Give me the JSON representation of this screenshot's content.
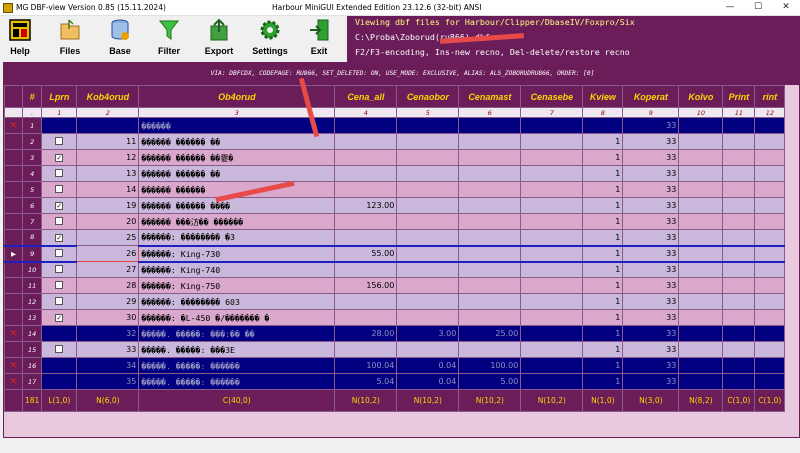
{
  "window": {
    "title": "MG DBF-view   Version 0.85 (15.11.2024)",
    "title_center": "Harbour MiniGUI Extended Edition 23.12.6 (32-bit) ANSI",
    "minimize": "—",
    "maximize": "☐",
    "close": "✕"
  },
  "toolbar": {
    "buttons": [
      {
        "label": "Help",
        "icon": "help-icon"
      },
      {
        "label": "Files",
        "icon": "folder-icon"
      },
      {
        "label": "Base",
        "icon": "database-icon"
      },
      {
        "label": "Filter",
        "icon": "filter-icon"
      },
      {
        "label": "Export",
        "icon": "export-icon"
      },
      {
        "label": "Settings",
        "icon": "gear-icon"
      },
      {
        "label": "Exit",
        "icon": "exit-icon"
      }
    ]
  },
  "info": {
    "line1": "Viewing dbf files for Harbour/Clipper/DbaseIV/Foxpro/Six",
    "line2": "C:\\Proba\\Zoborud(ru866).dbf",
    "line3": "F2/F3-encoding,   Ins-new recno, Del-delete/restore recno"
  },
  "grid": {
    "via_text": "VIA: DBFCDX, CODEPAGE: RU866, SET_DELETED: ON, USE_MODE: EXCLUSIVE, ALIAS: ALS_ZOBORUDRU866, ORDER: [0]",
    "headers": [
      "#",
      "Lprn",
      "Kob4orud",
      "Ob4orud",
      "Cena_all",
      "Cenaobor",
      "Cenamast",
      "Cenasebe",
      "Kview",
      "Koperat",
      "Kolvo",
      "Print",
      "rint"
    ],
    "col_numbers": [
      ".",
      "1",
      "2",
      "3",
      "4",
      "5",
      "6",
      "7",
      "8",
      "9",
      "10",
      "11",
      "12"
    ],
    "rows": [
      {
        "n": "1",
        "style": "del",
        "mark": "x",
        "lprn": "",
        "kob": "",
        "ob": "������",
        "cena_all": "",
        "cenaobor": "",
        "cenamast": "",
        "cenasebe": "",
        "kview": "",
        "koperat": "33",
        "kolvo": "",
        "print": "",
        "rint": ""
      },
      {
        "n": "2",
        "style": "a",
        "mark": "",
        "lprn": "☐",
        "kob": "11",
        "ob": "������ ������ ��",
        "cena_all": "",
        "cenaobor": "",
        "cenamast": "",
        "cenasebe": "",
        "kview": "1",
        "koperat": "33",
        "kolvo": "",
        "print": "",
        "rint": ""
      },
      {
        "n": "3",
        "style": "b",
        "mark": "",
        "lprn": "☑",
        "kob": "12",
        "ob": "������ ������ ��霎�",
        "cena_all": "",
        "cenaobor": "",
        "cenamast": "",
        "cenasebe": "",
        "kview": "1",
        "koperat": "33",
        "kolvo": "",
        "print": "",
        "rint": ""
      },
      {
        "n": "4",
        "style": "a",
        "mark": "",
        "lprn": "☐",
        "kob": "13",
        "ob": "������ ������ ��",
        "cena_all": "",
        "cenaobor": "",
        "cenamast": "",
        "cenasebe": "",
        "kview": "1",
        "koperat": "33",
        "kolvo": "",
        "print": "",
        "rint": ""
      },
      {
        "n": "5",
        "style": "b",
        "mark": "",
        "lprn": "☐",
        "kob": "14",
        "ob": "������ ������",
        "cena_all": "",
        "cenaobor": "",
        "cenamast": "",
        "cenasebe": "",
        "kview": "1",
        "koperat": "33",
        "kolvo": "",
        "print": "",
        "rint": ""
      },
      {
        "n": "6",
        "style": "a",
        "mark": "",
        "lprn": "☑",
        "kob": "19",
        "ob": "������ ������ ����",
        "cena_all": "123.00",
        "cenaobor": "",
        "cenamast": "",
        "cenasebe": "",
        "kview": "1",
        "koperat": "33",
        "kolvo": "",
        "print": "",
        "rint": ""
      },
      {
        "n": "7",
        "style": "b",
        "mark": "",
        "lprn": "☐",
        "kob": "20",
        "ob": "������ ���汸�� ������",
        "cena_all": "",
        "cenaobor": "",
        "cenamast": "",
        "cenasebe": "",
        "kview": "1",
        "koperat": "33",
        "kolvo": "",
        "print": "",
        "rint": ""
      },
      {
        "n": "8",
        "style": "a",
        "mark": "",
        "lprn": "☑",
        "kob": "25",
        "ob": "������: �������� �3",
        "cena_all": "",
        "cenaobor": "",
        "cenamast": "",
        "cenasebe": "",
        "kview": "1",
        "koperat": "33",
        "kolvo": "",
        "print": "",
        "rint": ""
      },
      {
        "n": "9",
        "style": "sel",
        "mark": "",
        "lprn": "☐",
        "kob": "26",
        "ob": "������: King-730",
        "cena_all": "55.00",
        "cenaobor": "",
        "cenamast": "",
        "cenasebe": "",
        "kview": "1",
        "koperat": "33",
        "kolvo": "",
        "print": "",
        "rint": ""
      },
      {
        "n": "10",
        "style": "a",
        "mark": "",
        "lprn": "☐",
        "kob": "27",
        "ob": "������: King-740",
        "cena_all": "",
        "cenaobor": "",
        "cenamast": "",
        "cenasebe": "",
        "kview": "1",
        "koperat": "33",
        "kolvo": "",
        "print": "",
        "rint": ""
      },
      {
        "n": "11",
        "style": "b",
        "mark": "",
        "lprn": "☐",
        "kob": "28",
        "ob": "������: King-750",
        "cena_all": "156.00",
        "cenaobor": "",
        "cenamast": "",
        "cenasebe": "",
        "kview": "1",
        "koperat": "33",
        "kolvo": "",
        "print": "",
        "rint": ""
      },
      {
        "n": "12",
        "style": "a",
        "mark": "",
        "lprn": "☐",
        "kob": "29",
        "ob": "������: �������� 603",
        "cena_all": "",
        "cenaobor": "",
        "cenamast": "",
        "cenasebe": "",
        "kview": "1",
        "koperat": "33",
        "kolvo": "",
        "print": "",
        "rint": ""
      },
      {
        "n": "13",
        "style": "b",
        "mark": "",
        "lprn": "☑",
        "kob": "30",
        "ob": "������: �L-450 �/������� �",
        "cena_all": "",
        "cenaobor": "",
        "cenamast": "",
        "cenasebe": "",
        "kview": "1",
        "koperat": "33",
        "kolvo": "",
        "print": "",
        "rint": ""
      },
      {
        "n": "14",
        "style": "del",
        "mark": "x",
        "lprn": "",
        "kob": "32",
        "ob": "�����. �����: ���:�� ��",
        "cena_all": "28.00",
        "cenaobor": "3.00",
        "cenamast": "25.00",
        "cenasebe": "",
        "kview": "1",
        "koperat": "33",
        "kolvo": "",
        "print": "",
        "rint": ""
      },
      {
        "n": "15",
        "style": "a",
        "mark": "",
        "lprn": "☐",
        "kob": "33",
        "ob": "�����. �����: ���3E",
        "cena_all": "",
        "cenaobor": "",
        "cenamast": "",
        "cenasebe": "",
        "kview": "1",
        "koperat": "33",
        "kolvo": "",
        "print": "",
        "rint": ""
      },
      {
        "n": "16",
        "style": "del",
        "mark": "x",
        "lprn": "",
        "kob": "34",
        "ob": "�����. �����: ������",
        "cena_all": "100.04",
        "cenaobor": "0.04",
        "cenamast": "100.00",
        "cenasebe": "",
        "kview": "1",
        "koperat": "33",
        "kolvo": "",
        "print": "",
        "rint": ""
      },
      {
        "n": "17",
        "style": "del",
        "mark": "x",
        "lprn": "",
        "kob": "35",
        "ob": "�����. �����: ������",
        "cena_all": "5.04",
        "cenaobor": "0.04",
        "cenamast": "5.00",
        "cenasebe": "",
        "kview": "1",
        "koperat": "33",
        "kolvo": "",
        "print": "",
        "rint": ""
      }
    ],
    "footer": [
      "181",
      "L(1,0)",
      "N(6,0)",
      "C(40,0)",
      "N(10,2)",
      "N(10,2)",
      "N(10,2)",
      "N(10,2)",
      "N(1,0)",
      "N(3,0)",
      "N(8,2)",
      "C(1,0)",
      "C(1,0)"
    ]
  }
}
